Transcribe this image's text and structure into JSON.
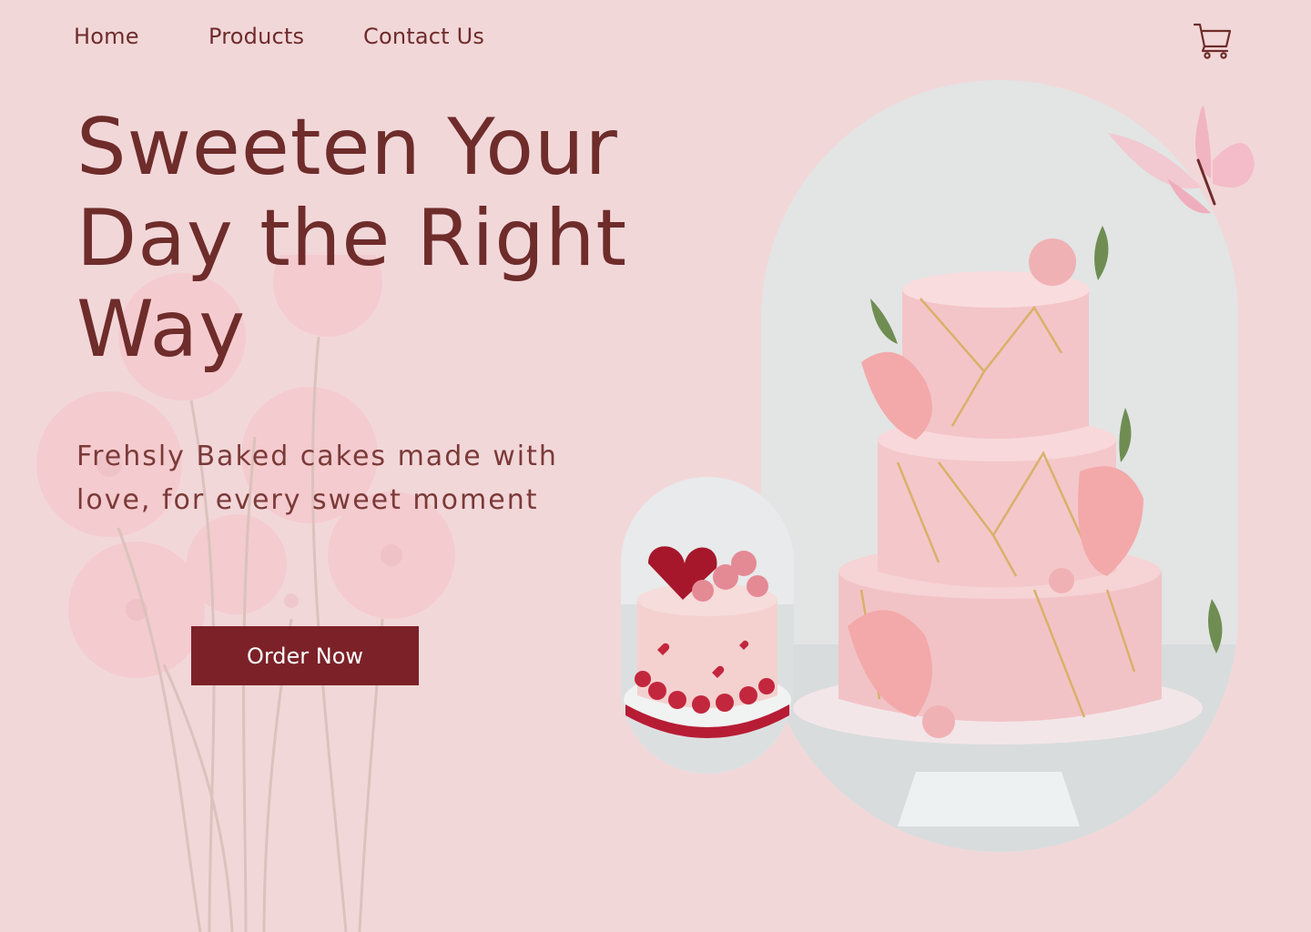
{
  "nav": {
    "links": [
      "Home",
      "Products",
      "Contact Us"
    ],
    "cart_icon": "shopping-cart-icon"
  },
  "hero": {
    "headline_lines": [
      "Sweeten Your",
      "Day the Right",
      "Way"
    ],
    "subtitle_lines": [
      "Frehsly Baked cakes made with",
      "love, for every sweet moment"
    ],
    "cta_label": "Order Now"
  },
  "colors": {
    "background": "#f2d7d9",
    "text_primary": "#6e2c2a",
    "button": "#7c2128",
    "button_text": "#ffffff"
  },
  "images": {
    "main": "three-tier-pink-geometric-cake-image",
    "secondary": "pink-heart-rosette-cake-image",
    "decoration": "pink-butterfly-icon"
  }
}
